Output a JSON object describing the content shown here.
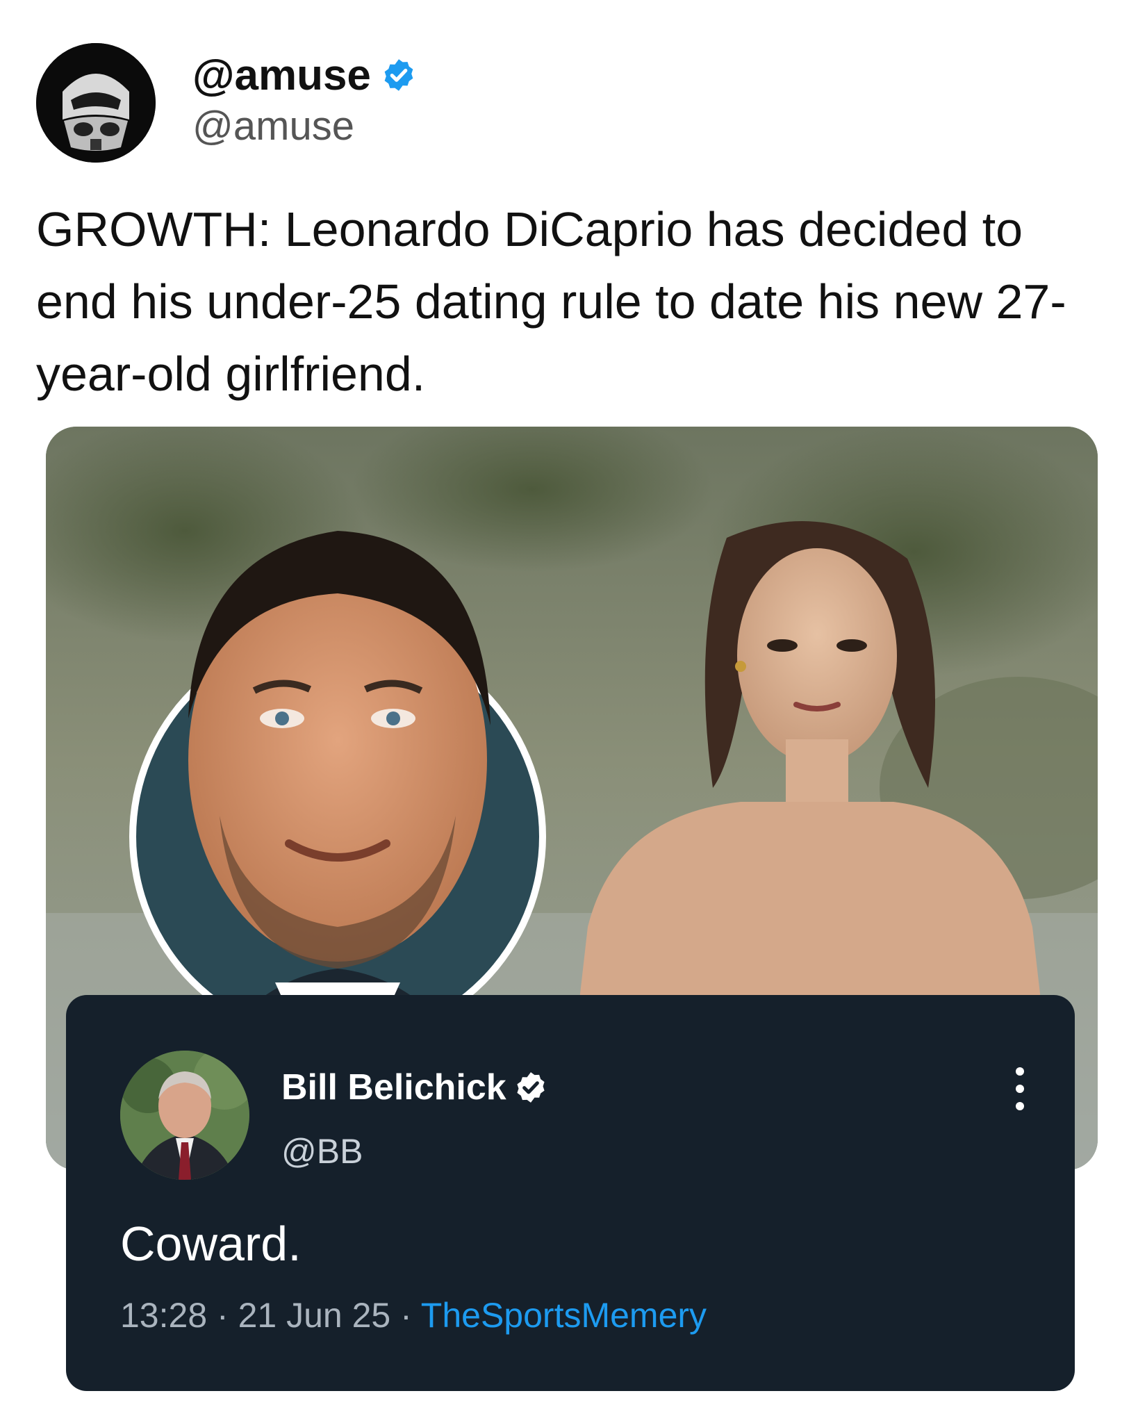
{
  "tweet": {
    "display_name": "@amuse",
    "handle": "@amuse",
    "text": "GROWTH: Leonardo DiCaprio has decided to end his under-25 dating rule to date his new 27-year-old girlfriend.",
    "verified_icon": "verified-badge-icon",
    "accent_color": "#1d9bf0"
  },
  "quote": {
    "display_name": "Bill Belichick",
    "handle": "@BB",
    "text": "Coward.",
    "time": "13:28",
    "date": "21 Jun 25",
    "separator": "·",
    "source": "TheSportsMemery",
    "background_color": "#15202b",
    "menu_icon": "more-vertical-icon"
  }
}
